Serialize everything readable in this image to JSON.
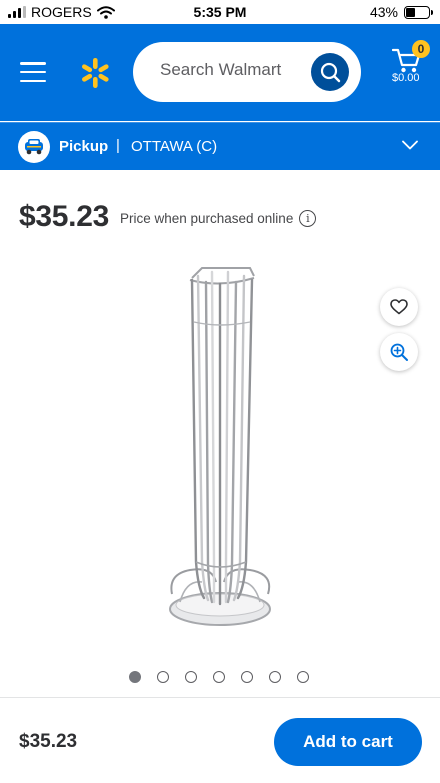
{
  "status_bar": {
    "carrier": "ROGERS",
    "time": "5:35 PM",
    "battery_percent": "43%",
    "battery_level": 0.43,
    "signal_bars_filled": 3,
    "signal_bars_total": 4
  },
  "header": {
    "menu_icon": "hamburger-menu-icon",
    "logo_icon": "walmart-spark-icon",
    "search_placeholder": "Search Walmart",
    "search_icon": "search-icon",
    "cart_icon": "cart-icon",
    "cart_count": "0",
    "cart_total": "$0.00",
    "brand_color": "#0071dc",
    "accent_color": "#ffc220"
  },
  "pickup": {
    "label": "Pickup",
    "separator": "|",
    "location": "OTTAWA (C)",
    "icon": "pickup-van-icon",
    "chevron_icon": "chevron-down-icon"
  },
  "product": {
    "price": "$35.23",
    "price_note": "Price when purchased online",
    "info_icon": "info-icon",
    "info_glyph": "i",
    "image_description_icon": "coffee-capsule-tower-image",
    "favorite_icon": "heart-icon",
    "zoom_icon": "zoom-in-icon"
  },
  "carousel": {
    "total_images": 7,
    "active_index": 0
  },
  "bottom_bar": {
    "price": "$35.23",
    "add_to_cart_label": "Add to cart"
  }
}
